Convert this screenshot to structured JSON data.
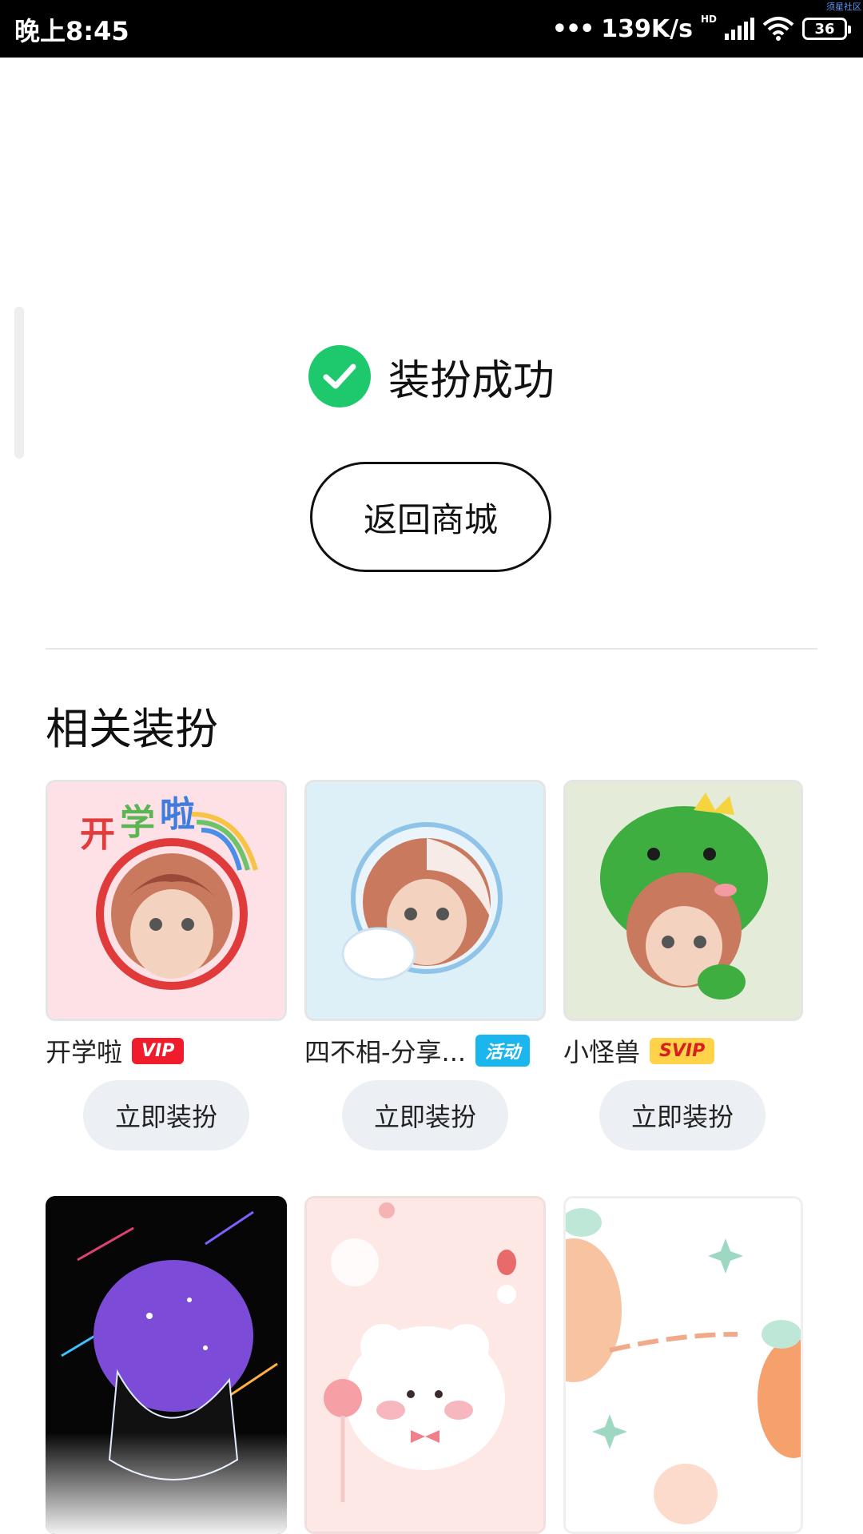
{
  "status_bar": {
    "time": "晚上8:45",
    "dots": "•••",
    "speed": "139K/s",
    "hd": "HD",
    "battery": "36",
    "corner_text": "须星社区"
  },
  "result": {
    "message": "装扮成功",
    "back_button": "返回商城",
    "check_color": "#1ec96d"
  },
  "related": {
    "title": "相关装扮",
    "items": [
      {
        "name": "开学啦",
        "badge": "VIP",
        "button": "立即装扮"
      },
      {
        "name": "四不相-分享...",
        "badge": "活动",
        "button": "立即装扮"
      },
      {
        "name": "小怪兽",
        "badge": "SVIP",
        "button": "立即装扮"
      }
    ]
  }
}
